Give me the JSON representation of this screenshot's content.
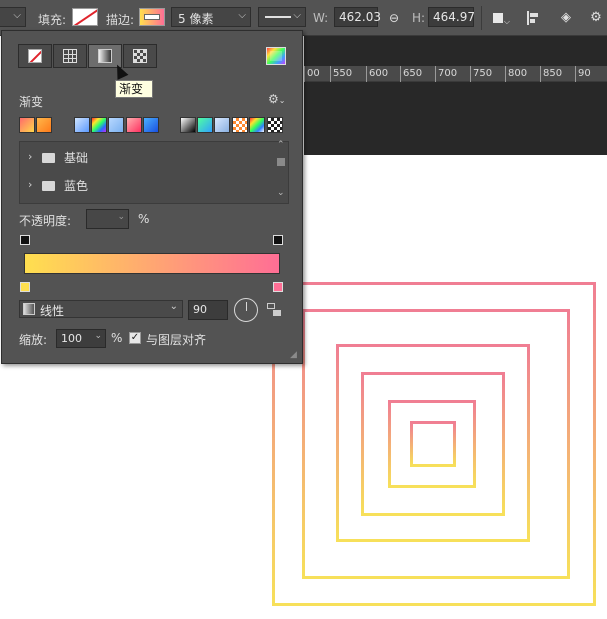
{
  "toolbar": {
    "fill_label": "填充:",
    "stroke_label": "描边:",
    "stroke_width": "5 像素",
    "w_label": "W:",
    "w_value": "462.03",
    "h_label": "H:",
    "h_value": "464.97"
  },
  "ruler": [
    "00",
    "550",
    "600",
    "650",
    "700",
    "750",
    "800",
    "850",
    "90"
  ],
  "panel": {
    "tooltip": "渐变",
    "section_title": "渐变",
    "folders": [
      {
        "name": "基础"
      },
      {
        "name": "蓝色"
      }
    ],
    "opacity_label": "不透明度:",
    "opacity_unit": "%",
    "gradient_from": "#ffdf4f",
    "gradient_to": "#ff6e95",
    "style_value": "线性",
    "angle_value": "90",
    "scale_label": "缩放:",
    "scale_value": "100",
    "scale_unit": "%",
    "align_label": "与图层对齐",
    "align_checked": "true"
  },
  "colors": {
    "panel_bg": "#535353",
    "canvas_bg": "#282828",
    "stroke_top": "#f07e93",
    "stroke_bottom": "#f7e05a"
  }
}
